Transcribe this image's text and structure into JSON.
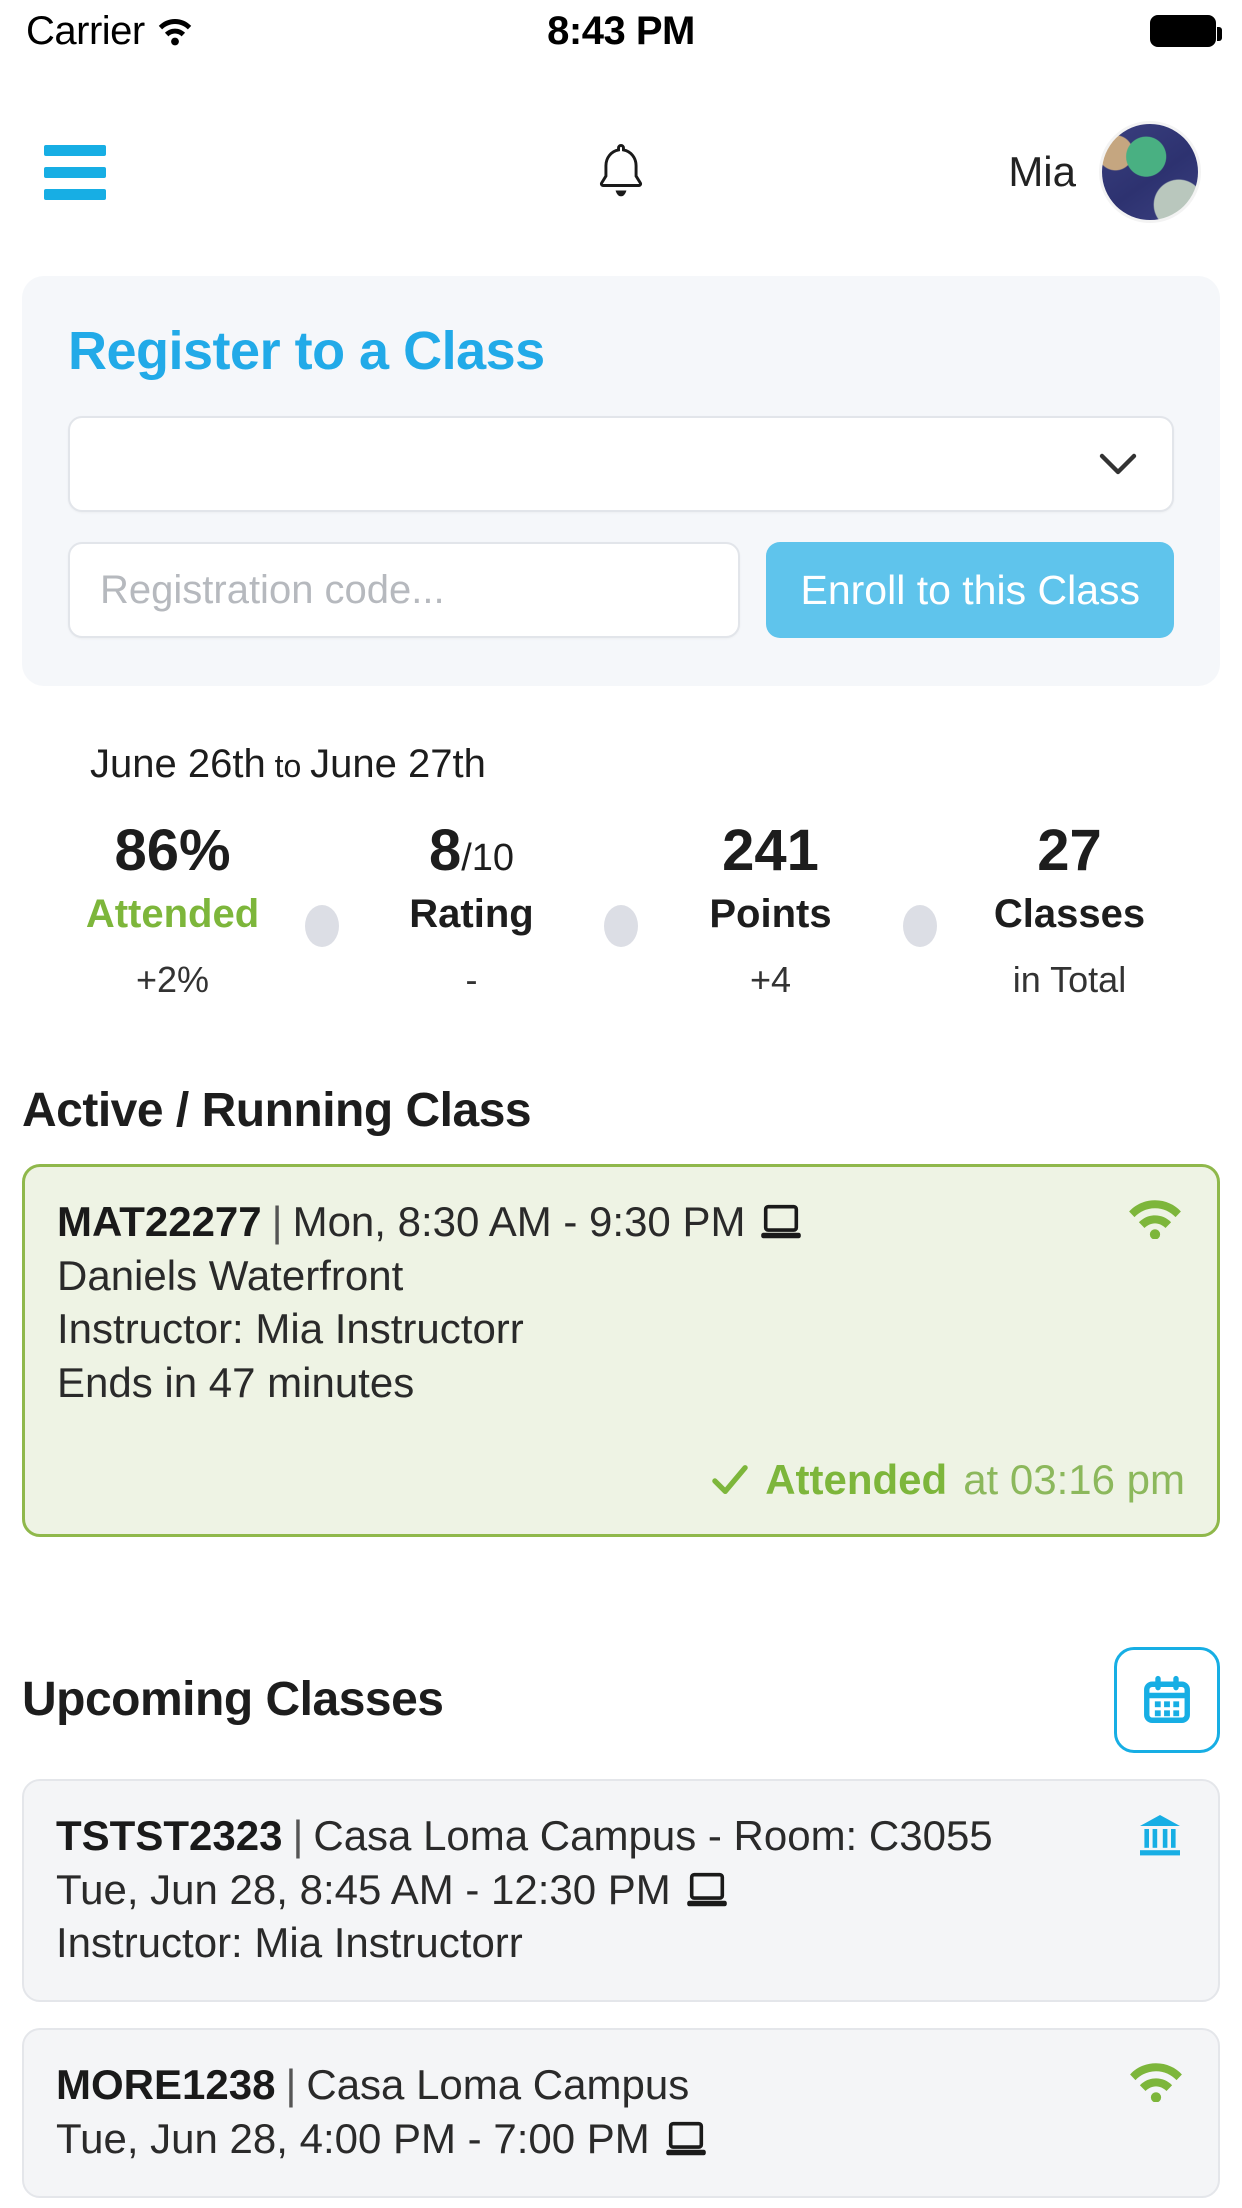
{
  "statusbar": {
    "carrier": "Carrier",
    "time": "8:43 PM",
    "wifi_icon": "wifi-icon",
    "battery_icon": "battery-icon"
  },
  "header": {
    "menu_icon": "hamburger-menu-icon",
    "bell_icon": "bell-icon",
    "username": "Mia",
    "avatar_icon": "user-avatar"
  },
  "register": {
    "title": "Register to a Class",
    "select_value": "",
    "select_placeholder": "",
    "chevron_icon": "chevron-down-icon",
    "code_value": "",
    "code_placeholder": "Registration code...",
    "enroll_label": "Enroll to this Class",
    "accent_color": "#22aae8",
    "button_color": "#5fc4ec"
  },
  "stats": {
    "date_range_prefix": "June 26th",
    "date_range_join": " to ",
    "date_range_suffix": "June 27th",
    "items": [
      {
        "value": "86%",
        "value_sub": "",
        "label": "Attended",
        "delta": "+2%",
        "label_color": "#7db63b"
      },
      {
        "value": "8",
        "value_sub": "/10",
        "label": "Rating",
        "delta": "-",
        "label_color": "#1d1d1d"
      },
      {
        "value": "241",
        "value_sub": "",
        "label": "Points",
        "delta": "+4",
        "label_color": "#1d1d1d"
      },
      {
        "value": "27",
        "value_sub": "",
        "label": "Classes",
        "delta": "in Total",
        "label_color": "#1d1d1d"
      }
    ]
  },
  "active_section": {
    "title": "Active / Running Class",
    "card": {
      "code": "MAT22277",
      "separator": "|",
      "schedule": "Mon, 8:30 AM - 9:30 PM",
      "device_icon": "laptop-icon",
      "status_icon": "wifi-icon",
      "location": "Daniels Waterfront",
      "instructor": "Instructor: Mia Instructorr",
      "ends_in": "Ends in 47 minutes",
      "check_icon": "check-icon",
      "attended_label": "Attended",
      "attended_time": "at 03:16 pm",
      "border_color": "#8fb84b",
      "background_color": "#eef3e4"
    }
  },
  "upcoming_section": {
    "title": "Upcoming Classes",
    "calendar_button_icon": "calendar-icon",
    "cards": [
      {
        "code": "TSTST2323",
        "separator": "|",
        "location": "Casa Loma Campus - Room: C3055",
        "schedule": "Tue, Jun 28, 8:45 AM - 12:30 PM",
        "device_icon": "laptop-icon",
        "status_icon": "bank-icon",
        "instructor": "Instructor: Mia Instructorr"
      },
      {
        "code": "MORE1238",
        "separator": "|",
        "location": "Casa Loma Campus",
        "schedule": "Tue, Jun 28, 4:00 PM - 7:00 PM",
        "device_icon": "laptop-icon",
        "status_icon": "wifi-icon",
        "instructor": ""
      }
    ]
  }
}
